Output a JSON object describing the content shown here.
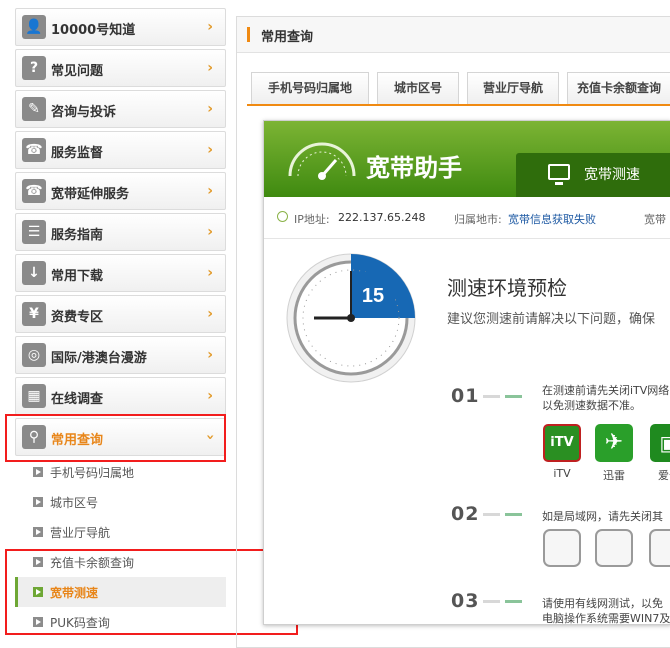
{
  "sidebar": {
    "items": [
      {
        "label": "10000号知道",
        "icon": "user-icon"
      },
      {
        "label": "常见问题",
        "icon": "question-icon"
      },
      {
        "label": "咨询与投诉",
        "icon": "document-icon"
      },
      {
        "label": "服务监督",
        "icon": "phone-icon"
      },
      {
        "label": "宽带延伸服务",
        "icon": "phone-icon"
      },
      {
        "label": "服务指南",
        "icon": "list-icon"
      },
      {
        "label": "常用下载",
        "icon": "download-icon"
      },
      {
        "label": "资费专区",
        "icon": "money-bag-icon"
      },
      {
        "label": "国际/港澳台漫游",
        "icon": "globe-icon"
      },
      {
        "label": "在线调查",
        "icon": "gift-icon"
      },
      {
        "label": "常用查询",
        "icon": "search-icon"
      }
    ],
    "subitems": [
      {
        "label": "手机号码归属地"
      },
      {
        "label": "城市区号"
      },
      {
        "label": "营业厅导航"
      },
      {
        "label": "充值卡余额查询"
      },
      {
        "label": "宽带测速"
      },
      {
        "label": "PUK码查询"
      }
    ]
  },
  "main": {
    "title": "常用查询",
    "tabs": [
      {
        "label": "手机号码归属地"
      },
      {
        "label": "城市区号"
      },
      {
        "label": "营业厅导航"
      },
      {
        "label": "充值卡余额查询"
      }
    ]
  },
  "app": {
    "title": "宽带助手",
    "speed_tab": "宽带测速",
    "ip_label": "IP地址:",
    "ip_value": "222.137.65.248",
    "region_label": "归属地市:",
    "region_value": "宽带信息获取失败",
    "region_extra": "宽带",
    "countdown": "15",
    "heading": "测速环境预检",
    "desc": "建议您测速前请解决以下问题，确保",
    "steps": [
      {
        "num": "01",
        "text1": "在测速前请先关闭iTV网络",
        "text2": "以免测速数据不准。"
      },
      {
        "num": "02",
        "text1": "如是局域网，请先关闭其",
        "text2": ""
      },
      {
        "num": "03",
        "text1": "请使用有线网测试，以免",
        "text2": "电脑操作系统需要WIN7及"
      }
    ],
    "apps": [
      {
        "name": "iTV",
        "badge": "iTV",
        "color": "#2a8f22"
      },
      {
        "name": "迅雷",
        "badge": "✈",
        "color": "#2a9f2a"
      },
      {
        "name": "爱奇",
        "badge": "▣",
        "color": "#1f8a1f"
      }
    ]
  },
  "colors": {
    "accent": "#f08a12",
    "green": "#4d9a16",
    "highlight_red": "#f21d1d"
  }
}
